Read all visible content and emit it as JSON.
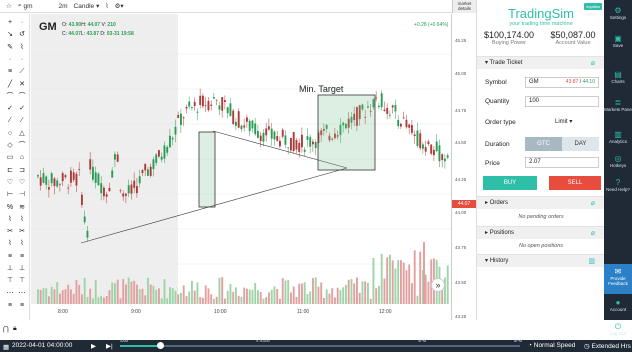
{
  "topbar": {
    "symbol": "gm",
    "interval": "2m",
    "chart_type": "Candle",
    "market_details": "market details"
  },
  "chart": {
    "symbol": "GM",
    "ohlc": {
      "o": "43.90",
      "h": "44.07",
      "v": "210",
      "c": "44.07",
      "l": "43.87",
      "d": "03-31 19:58"
    },
    "change": "+0.28 (+0.64%)",
    "price_tag": "44.07",
    "y_ticks": [
      "45.25",
      "45.00",
      "44.75",
      "44.50",
      "44.25",
      "44.00",
      "43.75",
      "43.50",
      "43.25"
    ],
    "x_ticks": [
      "8:00",
      "9:00",
      "10:00",
      "11:00",
      "12:00"
    ],
    "annotation": "Min. Target",
    "nav_icon": "double-chevron-right-icon"
  },
  "bottom": {
    "datetime": "2022-04-01   04:00:00",
    "timeline_labels": [
      "4AM",
      "9:30AM",
      "4PM",
      "8PM"
    ],
    "timeline_progress": 0.1,
    "speed": "Normal Speed",
    "extended": "Extended Hrs"
  },
  "panel": {
    "brand": "TradingSim",
    "tagline": "your trading time machine",
    "equities": "equities",
    "buying_power": "$100,174.00",
    "buying_power_label": "Buying Power",
    "account_value": "$50,087.00",
    "account_value_label": "Account Value",
    "trade_ticket": "Trade Ticket",
    "symbol_label": "Symbol",
    "symbol_value": "GM",
    "bid_ask_bid": "43.87",
    "bid_ask_ask": "44.10",
    "quantity_label": "Quantity",
    "quantity_value": "100",
    "order_type_label": "Order type",
    "order_type_value": "Limit",
    "duration_label": "Duration",
    "duration_gtc": "GTC",
    "duration_day": "DAY",
    "price_label": "Price",
    "price_value": "2.07",
    "buy": "BUY",
    "sell": "SELL",
    "orders": "Orders",
    "orders_empty": "No pending orders",
    "positions": "Positions",
    "positions_empty": "No open positions",
    "history": "History"
  },
  "rnav": [
    "Settings",
    "Save",
    "Charts",
    "Markets Pane",
    "Analytics",
    "Hotkeys",
    "Need Help?",
    "Provide Feedback",
    "Account",
    "Log Out"
  ],
  "colors": {
    "accent": "#2fbfa9",
    "up": "#2a9d55",
    "down": "#b03a3a",
    "nav": "#1f2a36",
    "sell": "#e74c3c"
  }
}
